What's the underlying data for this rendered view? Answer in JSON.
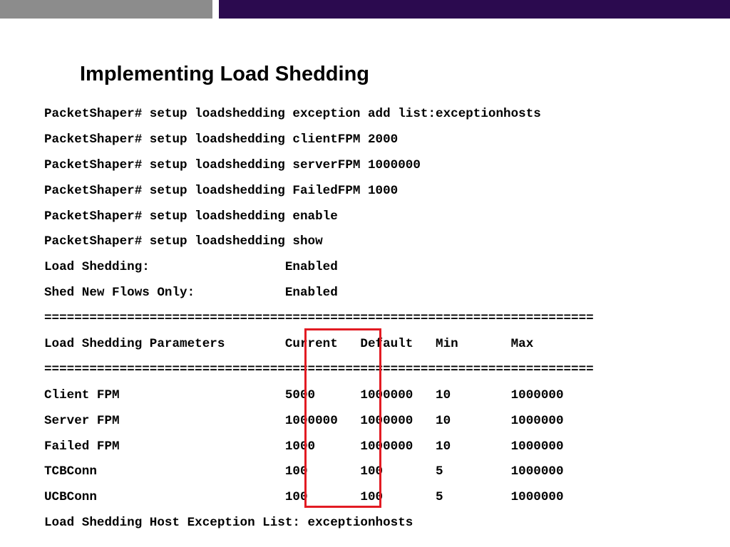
{
  "slide": {
    "title": "Implementing Load Shedding"
  },
  "colors": {
    "top_bar_gray": "#8c8c8c",
    "top_bar_purple": "#2b0a4f",
    "highlight_border": "#e21b23"
  },
  "console_lines": [
    "PacketShaper# setup loadshedding exception add list:exceptionhosts",
    "PacketShaper# setup loadshedding clientFPM 2000",
    "PacketShaper# setup loadshedding serverFPM 1000000",
    "PacketShaper# setup loadshedding FailedFPM 1000",
    "PacketShaper# setup loadshedding enable",
    "PacketShaper# setup loadshedding show",
    "Load Shedding:                  Enabled",
    "Shed New Flows Only:            Enabled",
    "=========================================================================",
    "Load Shedding Parameters        Current   Default   Min       Max",
    "=========================================================================",
    "Client FPM                      5000      1000000   10        1000000",
    "Server FPM                      1000000   1000000   10        1000000",
    "Failed FPM                      1000      1000000   10        1000000",
    "TCBConn                         100       100       5         1000000",
    "UCBConn                         100       100       5         1000000",
    "Load Shedding Host Exception List: exceptionhosts"
  ]
}
